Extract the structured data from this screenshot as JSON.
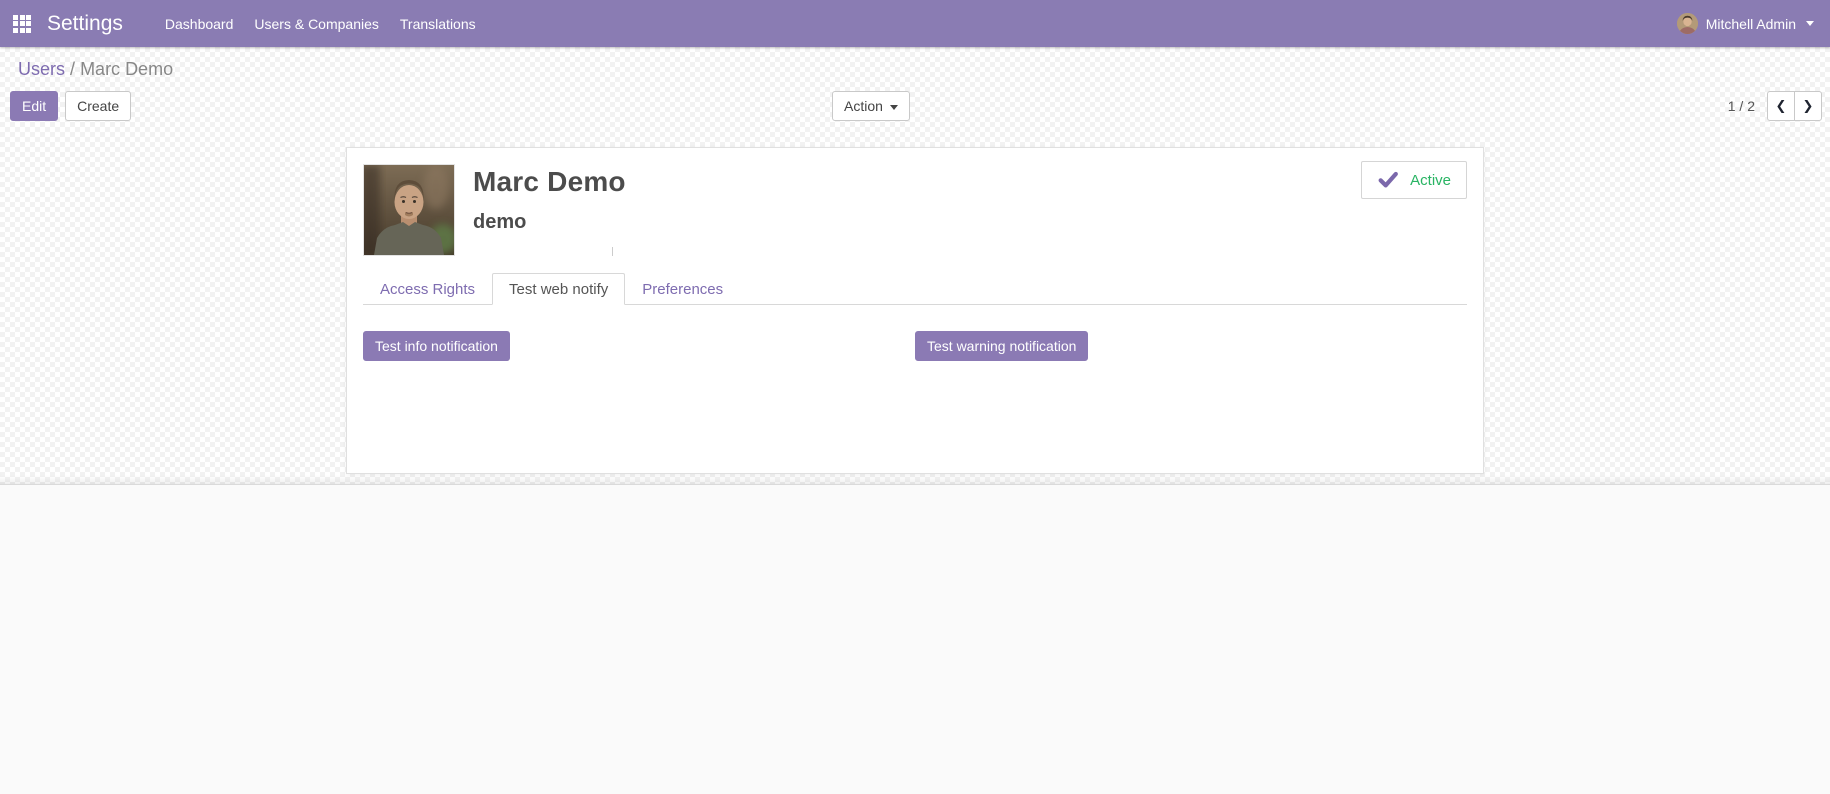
{
  "navbar": {
    "app_title": "Settings",
    "menus": [
      {
        "label": "Dashboard"
      },
      {
        "label": "Users & Companies"
      },
      {
        "label": "Translations"
      }
    ],
    "user": {
      "name": "Mitchell Admin"
    }
  },
  "breadcrumb": {
    "parent": "Users",
    "separator": "/",
    "current": "Marc Demo"
  },
  "control_panel": {
    "edit_label": "Edit",
    "create_label": "Create",
    "action_label": "Action",
    "pager": {
      "value": "1 / 2",
      "prev_icon": "❮",
      "next_icon": "❯"
    }
  },
  "form": {
    "name": "Marc Demo",
    "login": "demo",
    "status": {
      "label": "Active"
    },
    "tabs": [
      {
        "label": "Access Rights",
        "active": false
      },
      {
        "label": "Test web notify",
        "active": true
      },
      {
        "label": "Preferences",
        "active": false
      }
    ],
    "buttons": [
      {
        "label": "Test info notification"
      },
      {
        "label": "Test warning notification"
      }
    ]
  },
  "icons": {
    "apps_menu": "grid-icon",
    "user_caret": "chevron-down-icon",
    "action_caret": "chevron-down-icon",
    "pager_previous": "chevron-left-icon",
    "pager_next": "chevron-right-icon",
    "active_check": "check-icon"
  },
  "colors": {
    "navbar_bg": "#8a7cb3",
    "primary": "#8b7ab4",
    "link": "#7e6cb0",
    "active_green": "#28b463",
    "text": "#4c4c4c"
  }
}
